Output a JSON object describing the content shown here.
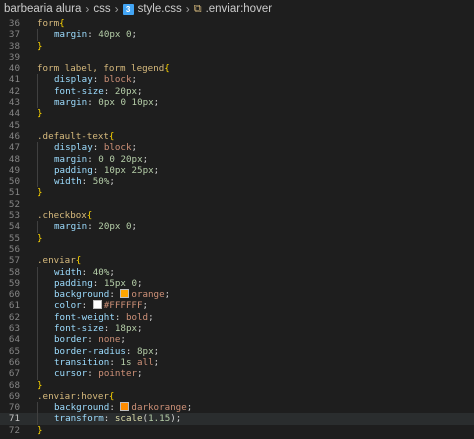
{
  "breadcrumb": {
    "folder": "barbearia alura",
    "subfolder": "css",
    "file": "style.css",
    "symbol": ".enviar:hover",
    "file_icon": "3"
  },
  "colors": {
    "orange": "#ffa500",
    "white": "#ffffff",
    "darkorange": "#ff8c00"
  },
  "lines": [
    {
      "n": "36",
      "t": "form{"
    },
    {
      "n": "37",
      "t": "margin: 40px 0;"
    },
    {
      "n": "38",
      "t": "}"
    },
    {
      "n": "39",
      "t": ""
    },
    {
      "n": "40",
      "t": "form label, form legend{"
    },
    {
      "n": "41",
      "t": "display: block;"
    },
    {
      "n": "42",
      "t": "font-size: 20px;"
    },
    {
      "n": "43",
      "t": "margin: 0px 0 10px;"
    },
    {
      "n": "44",
      "t": "}"
    },
    {
      "n": "45",
      "t": ""
    },
    {
      "n": "46",
      "t": ".default-text{"
    },
    {
      "n": "47",
      "t": "display: block;"
    },
    {
      "n": "48",
      "t": "margin: 0 0 20px;"
    },
    {
      "n": "49",
      "t": "padding: 10px 25px;"
    },
    {
      "n": "50",
      "t": "width: 50%;"
    },
    {
      "n": "51",
      "t": "}"
    },
    {
      "n": "52",
      "t": ""
    },
    {
      "n": "53",
      "t": ".checkbox{"
    },
    {
      "n": "54",
      "t": "margin: 20px 0;"
    },
    {
      "n": "55",
      "t": "}"
    },
    {
      "n": "56",
      "t": ""
    },
    {
      "n": "57",
      "t": ".enviar{"
    },
    {
      "n": "58",
      "t": "width: 40%;"
    },
    {
      "n": "59",
      "t": "padding: 15px 0;"
    },
    {
      "n": "60",
      "t": "background: orange;"
    },
    {
      "n": "61",
      "t": "color: #FFFFFF;"
    },
    {
      "n": "62",
      "t": "font-weight: bold;"
    },
    {
      "n": "63",
      "t": "font-size: 18px;"
    },
    {
      "n": "64",
      "t": "border: none;"
    },
    {
      "n": "65",
      "t": "border-radius: 8px;"
    },
    {
      "n": "66",
      "t": "transition: 1s all;"
    },
    {
      "n": "67",
      "t": "cursor: pointer;"
    },
    {
      "n": "68",
      "t": "}"
    },
    {
      "n": "69",
      "t": ".enviar:hover{"
    },
    {
      "n": "70",
      "t": "background: darkorange;"
    },
    {
      "n": "71",
      "t": "transform: scale(1.15);"
    },
    {
      "n": "72",
      "t": "}"
    }
  ]
}
